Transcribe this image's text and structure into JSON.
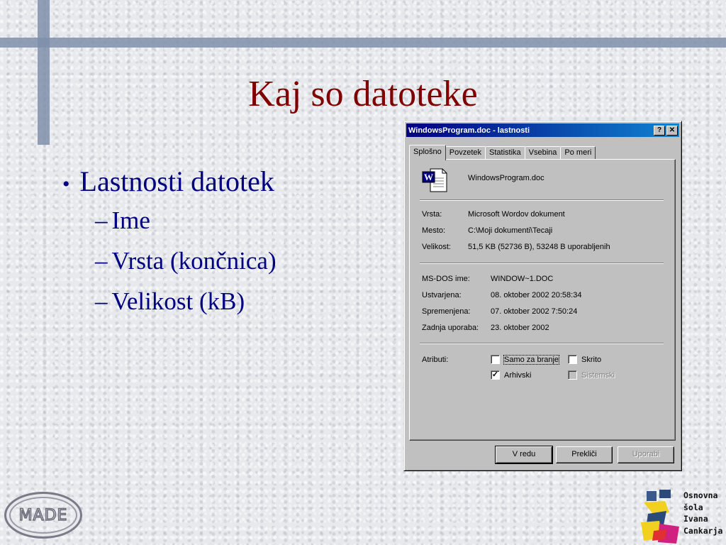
{
  "slide": {
    "title": "Kaj so datoteke",
    "bullet": "Lastnosti datotek",
    "bullet_marker": "•",
    "sub_marker": "–",
    "sub_items": [
      "Ime",
      "Vrsta (končnica)",
      "Velikost (kB)"
    ]
  },
  "dialog": {
    "title": "WindowsProgram.doc - lastnosti",
    "help_button": "?",
    "close_button": "✕",
    "tabs": [
      "Splošno",
      "Povzetek",
      "Statistika",
      "Vsebina",
      "Po meri"
    ],
    "active_tab": "Splošno",
    "icon": "word-document-icon",
    "file_name": "WindowsProgram.doc",
    "props": {
      "type_label": "Vrsta:",
      "type_value": "Microsoft Wordov dokument",
      "location_label": "Mesto:",
      "location_value": "C:\\Moji dokumenti\\Tecaji",
      "size_label": "Velikost:",
      "size_value": "51,5 KB (52736 B), 53248 B uporabljenih"
    },
    "dates": {
      "msdos_label": "MS-DOS ime:",
      "msdos_value": "WINDOW~1.DOC",
      "created_label": "Ustvarjena:",
      "created_value": "08. oktober 2002 20:58:34",
      "modified_label": "Spremenjena:",
      "modified_value": "07. oktober 2002 7:50:24",
      "accessed_label": "Zadnja uporaba:",
      "accessed_value": "23. oktober 2002"
    },
    "attributes": {
      "label": "Atributi:",
      "readonly": {
        "label": "Samo za branje",
        "checked": false
      },
      "hidden": {
        "label": "Skrito",
        "checked": false
      },
      "archive": {
        "label": "Arhivski",
        "checked": true,
        "mark": "✓"
      },
      "system": {
        "label": "Sistemski",
        "checked": false,
        "disabled": true
      }
    },
    "buttons": {
      "ok": "V redu",
      "cancel": "Prekliči",
      "apply": "Uporabi"
    }
  },
  "logos": {
    "left_text": "MADE",
    "right_text": [
      "Osnovna",
      "šola",
      "Ivana",
      "Cankarja"
    ]
  },
  "colors": {
    "title": "#800000",
    "body_text": "#000080",
    "titlebar_start": "#000080",
    "titlebar_end": "#1084d0",
    "dialog_face": "#c0c0c0"
  }
}
